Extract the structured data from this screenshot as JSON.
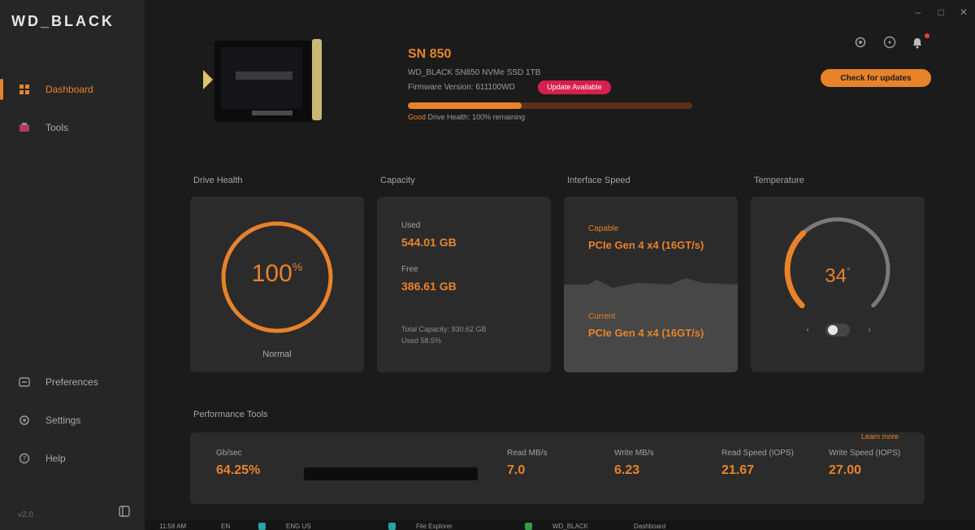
{
  "app": {
    "logo": "WD_BLACK"
  },
  "window_controls": {
    "minimize": "–",
    "maximize": "□",
    "close": "✕"
  },
  "sidebar": {
    "items": [
      {
        "label": "Dashboard",
        "icon": "dashboard-icon",
        "active": true
      },
      {
        "label": "Tools",
        "icon": "tools-icon",
        "active": false
      }
    ],
    "bottom_items": [
      {
        "label": "Preferences",
        "icon": "preferences-icon"
      },
      {
        "label": "Settings",
        "icon": "settings-icon"
      },
      {
        "label": "Help",
        "icon": "help-icon"
      }
    ],
    "version": "v2.0",
    "collapse_icon": "collapse-icon"
  },
  "header": {
    "drive_name": "SN 850",
    "line1": "WD_BLACK SN850 NVMe SSD 1TB",
    "line2": "Firmware Version: 611100WD",
    "firmware_badge": "Update Available",
    "health_percent": 40,
    "health_status": "Good",
    "health_text": "Drive Health: 100% remaining",
    "icons": [
      "settings-icon",
      "help-icon",
      "notifications-icon"
    ],
    "primary_button": "Check for updates"
  },
  "cards": {
    "drive_health": {
      "title": "Drive Health",
      "value": "100",
      "unit": "%",
      "label": "Normal"
    },
    "capacity": {
      "title": "Capacity",
      "used_label": "Used",
      "used_value": "544.01 GB",
      "free_label": "Free",
      "free_value": "386.61 GB",
      "note_line1": "Total Capacity: 930.62 GB",
      "note_line2": "Used 58.5%"
    },
    "memory_speed": {
      "title": "Interface Speed",
      "top_label": "Capable",
      "top_value": "PCIe Gen 4 x4 (16GT/s)",
      "bottom_label": "Current",
      "bottom_value": "PCIe Gen 4 x4 (16GT/s)"
    },
    "temperature": {
      "title": "Temperature",
      "value": "34",
      "unit": "°",
      "percent": 0.34,
      "prev_icon": "chevron-left-icon",
      "next_icon": "chevron-right-icon"
    }
  },
  "performance": {
    "title": "Performance Tools",
    "link": "Learn more",
    "bar_label": "Gb/sec",
    "bar_value": "64.25%",
    "metrics": [
      {
        "label": "Read MB/s",
        "value": "7.0"
      },
      {
        "label": "Write MB/s",
        "value": "6.23"
      },
      {
        "label": "Read Speed (IOPS)",
        "value": "21.67"
      },
      {
        "label": "Write Speed (IOPS)",
        "value": "27.00"
      }
    ]
  },
  "taskbar": {
    "items": [
      "11:58 AM",
      "EN",
      "ENG US",
      "File Explorer",
      "WD_BLACK",
      "Dashboard"
    ]
  },
  "colors": {
    "accent": "#e8832a",
    "badge": "#d8204f",
    "background": "#1b1b1b",
    "card": "#2b2b2b",
    "sidebar": "#262626"
  }
}
